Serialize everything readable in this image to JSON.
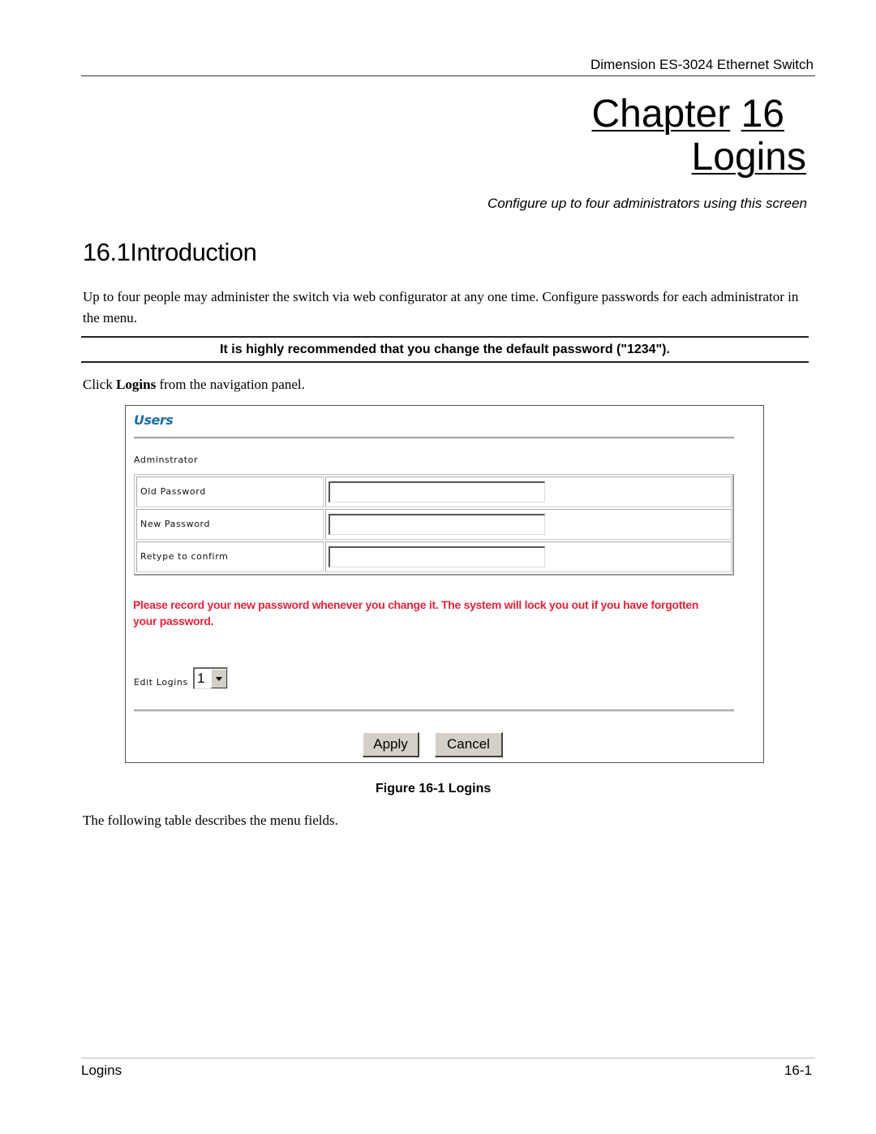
{
  "running_header": "Dimension ES-3024 Ethernet Switch",
  "chapter": {
    "word": "Chapter",
    "number": "16",
    "title": "Logins",
    "subtitle": "Configure up to four administrators using this screen"
  },
  "section": {
    "heading": "16.1Introduction",
    "intro": "Up to four people may administer the switch via web configurator at any one time. Configure passwords for each administrator in the menu.",
    "note": "It is highly recommended that you change the default password (\"1234\").",
    "click_prefix": "Click ",
    "click_bold": "Logins",
    "click_suffix": " from the navigation panel."
  },
  "screenshot": {
    "title": "Users",
    "admin_label": "Adminstrator",
    "fields": [
      {
        "label": "Old Password",
        "value": ""
      },
      {
        "label": "New Password",
        "value": ""
      },
      {
        "label": "Retype to confirm",
        "value": ""
      }
    ],
    "warning": "Please record your new password whenever you change it. The system will lock you out if you have forgotten your password.",
    "edit_logins_label": "Edit Logins",
    "edit_logins_value": "1",
    "apply_label": "Apply",
    "cancel_label": "Cancel",
    "colors": {
      "title": "#1c6fa8",
      "warning": "#e5233a",
      "button_face": "#d4d0c8"
    }
  },
  "figure_caption": "Figure 16-1 Logins",
  "following_text": "The following table describes the menu fields.",
  "footer": {
    "left": "Logins",
    "right": "16-1"
  }
}
